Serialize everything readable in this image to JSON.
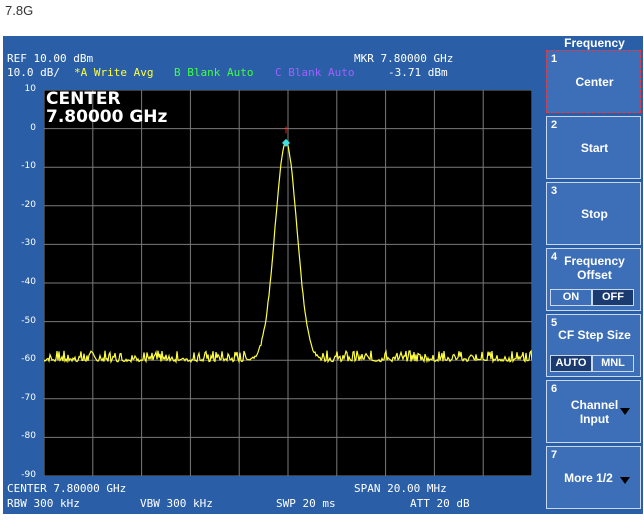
{
  "caption": "7.8G",
  "header": {
    "ref": "REF  10.00 dBm",
    "scale": "10.0 dB/",
    "trace_a": "*A Write Avg",
    "trace_b": "B Blank Auto",
    "trace_c": "C Blank Auto",
    "marker_freq": "MKR 7.80000 GHz",
    "marker_level": "-3.71 dBm"
  },
  "overlay": {
    "line1": "CENTER",
    "line2": "7.80000 GHz"
  },
  "footer": {
    "center": "CENTER 7.80000 GHz",
    "span": "SPAN 20.00 MHz",
    "rbw": "RBW  300 kHz",
    "vbw": "VBW  300 kHz",
    "swp": "SWP  20 ms",
    "att": "ATT  20 dB"
  },
  "colors": {
    "trace_a": "#ffff40",
    "trace_b": "#40ff40",
    "trace_c": "#a060ff",
    "frame": "#2a5fa8",
    "marker": "#40e0e0"
  },
  "yaxis": {
    "ticks": [
      "10",
      "0",
      "-10",
      "-20",
      "-30",
      "-40",
      "-50",
      "-60",
      "-70",
      "-80",
      "-90"
    ],
    "max": 10,
    "min": -90
  },
  "spectrum": {
    "center_ghz": 7.8,
    "span_mhz": 20,
    "noise_floor_dbm": -60,
    "peak_dbm": -3.71,
    "marker_dbm": -3.71
  },
  "softkeys": {
    "title": "Frequency",
    "items": [
      {
        "num": "1",
        "label": "Center"
      },
      {
        "num": "2",
        "label": "Start"
      },
      {
        "num": "3",
        "label": "Stop"
      },
      {
        "num": "4",
        "label1": "Frequency",
        "label2": "Offset",
        "opt1": "ON",
        "opt2": "OFF"
      },
      {
        "num": "5",
        "label": "CF Step Size",
        "opt1": "AUTO",
        "opt2": "MNL"
      },
      {
        "num": "6",
        "label1": "Channel",
        "label2": "Input"
      },
      {
        "num": "7",
        "label": "More 1/2"
      }
    ]
  }
}
